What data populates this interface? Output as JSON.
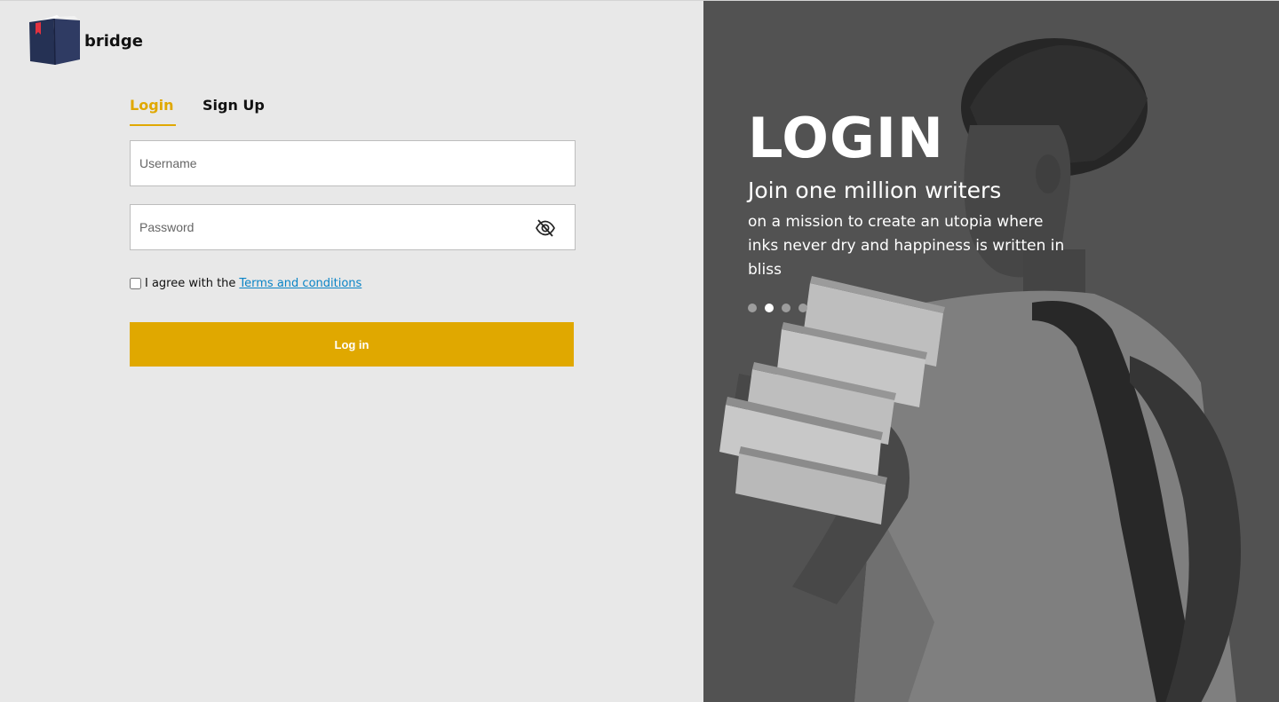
{
  "brand": {
    "name": "bridge",
    "logo_icon": "book-icon"
  },
  "tabs": [
    {
      "label": "Login",
      "active": true
    },
    {
      "label": "Sign Up",
      "active": false
    }
  ],
  "form": {
    "username_placeholder": "Username",
    "username_value": "",
    "password_placeholder": "Password",
    "password_value": "",
    "password_toggle_icon": "eye-off-icon",
    "agree_text": "I agree with the",
    "agree_checked": false,
    "terms_link": "Terms and conditions",
    "submit_label": "Log in"
  },
  "hero": {
    "title": "LOGIN",
    "subtitle": "Join one million writers",
    "body": "on a mission to create an utopia where inks never dry and happiness is written in bliss",
    "carousel_count": 4,
    "carousel_active_index": 1
  },
  "colors": {
    "accent": "#e0a800",
    "link": "#0a84c6",
    "background": "#e8e8e8",
    "hero_overlay": "#585858"
  }
}
